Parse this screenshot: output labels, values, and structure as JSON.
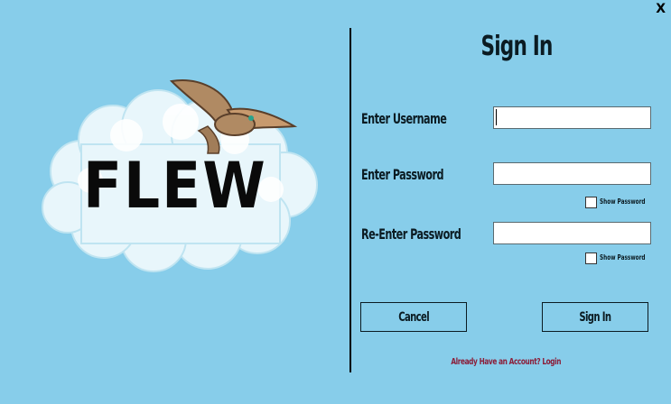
{
  "window": {
    "close_label": "X"
  },
  "logo": {
    "text": "FLEW"
  },
  "form": {
    "title": "Sign In",
    "username_label": "Enter Username",
    "password_label": "Enter Password",
    "reenter_label": "Re-Enter Password",
    "username_value": "",
    "password_value": "",
    "reenter_value": "",
    "show_password_label": "Show Password",
    "cancel_label": "Cancel",
    "submit_label": "Sign In",
    "login_link": "Already Have an Account? Login"
  },
  "colors": {
    "background": "#87cdea",
    "link": "#8b1f3a",
    "text": "#0b1b22"
  }
}
